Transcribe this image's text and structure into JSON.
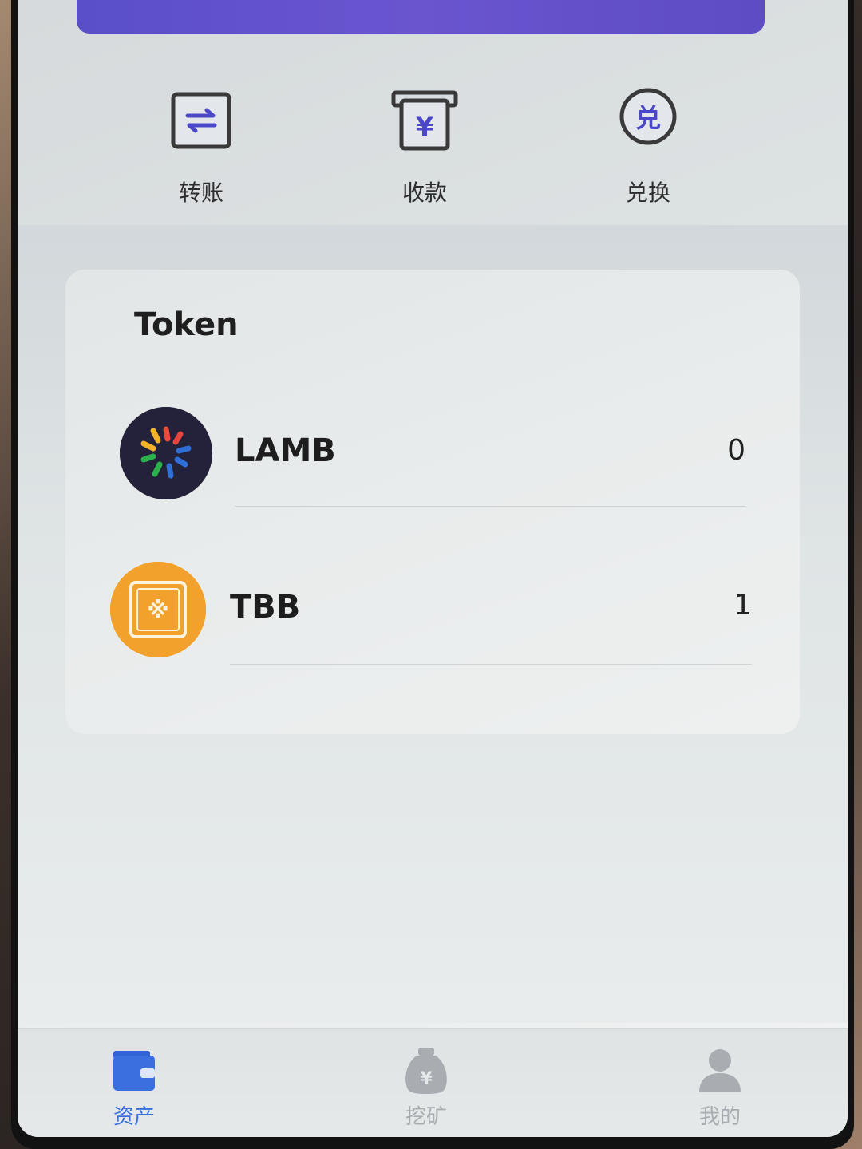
{
  "quick_actions": [
    {
      "label": "转账",
      "icon": "transfer-icon"
    },
    {
      "label": "收款",
      "icon": "receive-yen-icon"
    },
    {
      "label": "兑换",
      "icon": "exchange-icon",
      "glyph": "兑"
    }
  ],
  "token_section": {
    "title": "Token",
    "tokens": [
      {
        "symbol": "LAMB",
        "balance": "0",
        "icon": "lamb-logo-icon"
      },
      {
        "symbol": "TBB",
        "balance": "1",
        "icon": "tbb-logo-icon"
      }
    ]
  },
  "tabbar": [
    {
      "label": "资产",
      "icon": "wallet-icon",
      "active": true
    },
    {
      "label": "挖矿",
      "icon": "money-bag-icon",
      "active": false
    },
    {
      "label": "我的",
      "icon": "profile-icon",
      "active": false
    }
  ],
  "colors": {
    "accent": "#3b6fe0",
    "banner": "#5a4fc8",
    "inactive_tab": "#a9adb1",
    "icon_purple": "#4b47c9"
  },
  "icons": {
    "yen_glyph": "¥"
  }
}
